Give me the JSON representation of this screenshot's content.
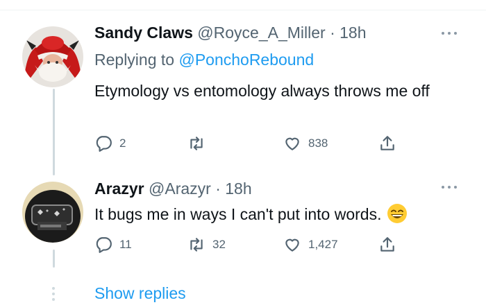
{
  "tweets": [
    {
      "display_name": "Sandy Claws",
      "handle": "@Royce_A_Miller",
      "time": "18h",
      "reply_prefix": "Replying to",
      "reply_handle": "@PonchoRebound",
      "text": "Etymology vs entomology always throws me off",
      "avatar_icon": "santa-avatar",
      "actions": {
        "reply": "2",
        "retweet": "",
        "like": "838",
        "share": ""
      }
    },
    {
      "display_name": "Arazyr",
      "handle": "@Arazyr",
      "time": "18h",
      "text": "It bugs me in ways I can't put into words.",
      "emoji_icon": "grinning-face-emoji",
      "avatar_icon": "cube-helmet-avatar",
      "actions": {
        "reply": "11",
        "retweet": "32",
        "like": "1,427",
        "share": ""
      }
    }
  ],
  "separator": "·",
  "show_replies": "Show replies",
  "colors": {
    "accent": "#1d9bf0",
    "secondary_text": "#536471",
    "primary_text": "#0f1419",
    "thread_line": "#cfd9de"
  }
}
